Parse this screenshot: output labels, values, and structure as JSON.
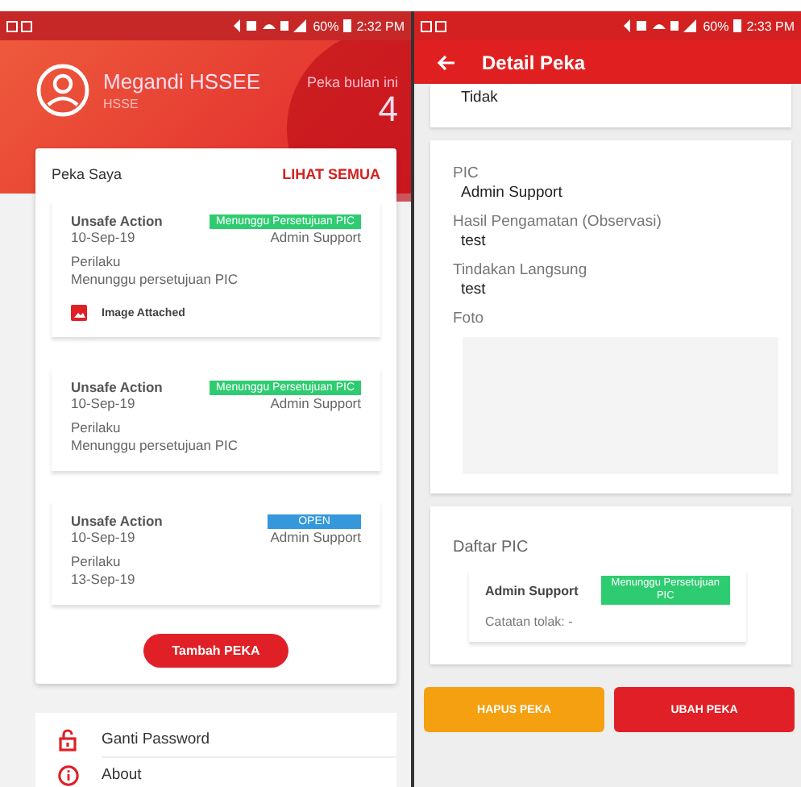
{
  "left_screen": {
    "status_bar": {
      "battery": "60%",
      "time": "2:32 PM"
    },
    "profile": {
      "name": "Megandi HSSEE",
      "role": "HSSE"
    },
    "month_counter": {
      "label": "Peka bulan ini",
      "value": "4"
    },
    "peka_card": {
      "title": "Peka Saya",
      "link": "LIHAT SEMUA",
      "items": [
        {
          "type": "Unsafe Action",
          "date": "10-Sep-19",
          "status": "Menunggu Persetujuan PIC",
          "color": "#2ecc71",
          "pic": "Admin Support",
          "category": "Perilaku",
          "note": "Menunggu persetujuan PIC",
          "attachment": "Image Attached"
        },
        {
          "type": "Unsafe Action",
          "date": "10-Sep-19",
          "status": "Menunggu Persetujuan PIC",
          "color": "#2ecc71",
          "pic": "Admin Support",
          "category": "Perilaku",
          "note": "Menunggu persetujuan PIC"
        },
        {
          "type": "Unsafe Action",
          "date": "10-Sep-19",
          "status": "OPEN",
          "color": "#3498db",
          "pic": "Admin Support",
          "category": "Perilaku",
          "note": "13-Sep-19"
        }
      ],
      "button": "Tambah PEKA"
    },
    "menu": [
      {
        "label": "Ganti Password"
      },
      {
        "label": "About"
      }
    ]
  },
  "right_screen": {
    "status_bar": {
      "battery": "60%",
      "time": "2:33 PM"
    },
    "app_bar": {
      "title": "Detail Peka"
    },
    "top_value": "Tidak",
    "fields": [
      {
        "label": "PIC",
        "value": "Admin Support"
      },
      {
        "label": "Hasil Pengamatan (Observasi)",
        "value": "test"
      },
      {
        "label": "Tindakan Langsung",
        "value": "test"
      }
    ],
    "photo": {
      "label": "Foto"
    },
    "pic_list": {
      "title": "Daftar PIC",
      "items": [
        {
          "name": "Admin Support",
          "status": "Menunggu Persetujuan PIC",
          "color": "#2ecc71",
          "note": "Catatan tolak: -"
        }
      ]
    },
    "buttons": [
      {
        "label": "HAPUS PEKA",
        "color": "#f5a011"
      },
      {
        "label": "UBAH PEKA",
        "color": "#e02026"
      }
    ]
  }
}
